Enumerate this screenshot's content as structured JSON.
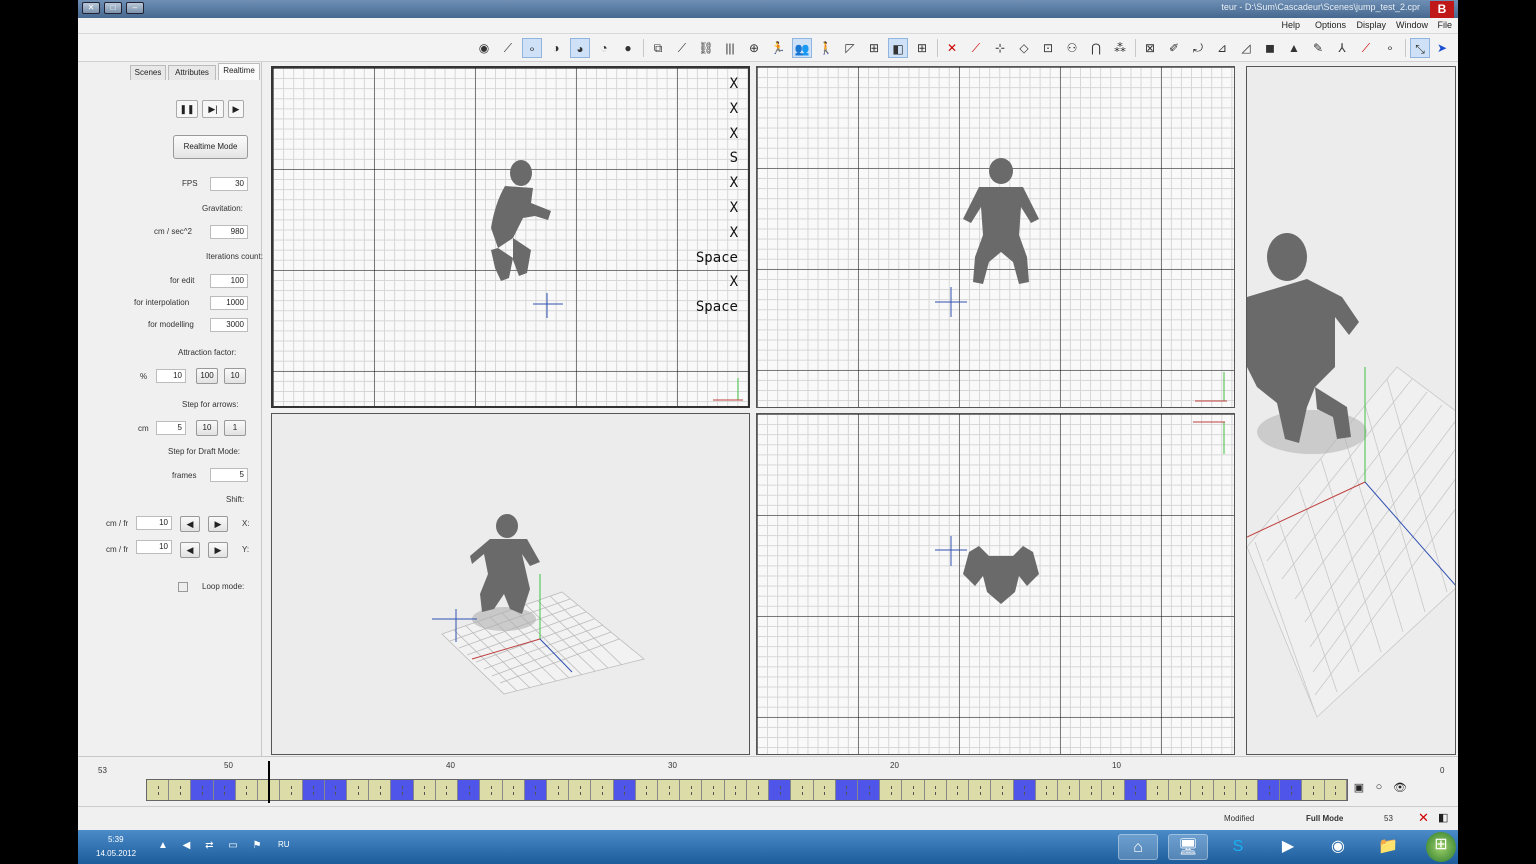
{
  "window": {
    "title": "teur - D:\\Sum\\Cascadeur\\Scenes\\jump_test_2.cpr",
    "logo": "B"
  },
  "menu": [
    {
      "label": "File",
      "id": "menu-file"
    },
    {
      "label": "Window",
      "id": "menu-window"
    },
    {
      "label": "Display",
      "id": "menu-display"
    },
    {
      "label": "Options",
      "id": "menu-options"
    },
    {
      "label": "Help",
      "id": "menu-help"
    }
  ],
  "toolbar_icons": [
    "pointer-icon",
    "move-icon",
    "dot-icon",
    "bone-icon",
    "brush-icon",
    "figure-icon",
    "bone-chain-icon",
    "cube-icon",
    "pencil-icon",
    "triangle-icon",
    "scale-icon",
    "rotate-icon",
    "nodes-icon",
    "node-icon",
    "arch-icon",
    "hierarchy-icon",
    "square-icon",
    "diamond-icon",
    "pin-icon",
    "red-brush-icon",
    "delete-icon",
    "grid4-icon",
    "panel-icon",
    "grid-icon",
    "corner-icon",
    "walk-icon",
    "people-icon",
    "run-icon",
    "target-icon",
    "bars-icon",
    "chain-icon",
    "link-icon",
    "window-icon",
    "dot-icon-2",
    "circle-icon",
    "brush2-icon",
    "pencil2-icon",
    "dot-small-icon",
    "line-icon",
    "pin2-icon"
  ],
  "panel": {
    "tabs": [
      "Realtime",
      "Attributes",
      "Scenes"
    ],
    "playback": {
      "play": "▶",
      "step": "▶|",
      "pause": "❚❚"
    },
    "realtime_mode_label": "Realtime Mode",
    "fps": {
      "label": "FPS",
      "value": "30"
    },
    "gravitation": {
      "title": "Gravitation:",
      "value": "980",
      "unit": "cm / sec^2"
    },
    "iterations": {
      "title": "Iterations count:",
      "edit": {
        "value": "100",
        "label": "for edit"
      },
      "interp": {
        "value": "1000",
        "label": "for interpolation"
      },
      "model": {
        "value": "3000",
        "label": "for modelling"
      }
    },
    "attraction": {
      "title": "Attraction factor:",
      "b1": "10",
      "b2": "100",
      "value": "10",
      "unit": "%"
    },
    "arrows": {
      "title": "Step for arrows:",
      "b1": "1",
      "b2": "10",
      "value": "5",
      "unit": "cm"
    },
    "draft": {
      "title": "Step for Draft Mode:",
      "value": "5",
      "unit": "frames"
    },
    "shift": {
      "title": "Shift:",
      "x": {
        "label": "X:",
        "value": "10",
        "unit": "cm / fr"
      },
      "y": {
        "label": "Y:",
        "value": "10",
        "unit": "cm / fr"
      }
    },
    "loop": {
      "label": "Loop mode:",
      "checked": false
    }
  },
  "viewports": {
    "side_keys": [
      "X",
      "X",
      "X",
      "S",
      "X",
      "X",
      "X",
      "Space",
      "X",
      "Space"
    ]
  },
  "timeline": {
    "start": "0",
    "end": "53",
    "labels": [
      "10",
      "20",
      "30",
      "40",
      "50"
    ],
    "current_frame": 48,
    "total_frames": 54,
    "key_frames": [
      2,
      3,
      9,
      14,
      21,
      22,
      25,
      32,
      36,
      39,
      42,
      45,
      46,
      50,
      51
    ]
  },
  "status": {
    "frame": "53",
    "mode": "Full Mode",
    "state": "Modified"
  },
  "taskbar": {
    "lang": "RU",
    "time": "5:39",
    "date": "14.05.2012",
    "apps": [
      "start-orb",
      "explorer-app",
      "chrome-app",
      "media-app",
      "skype-app",
      "computer-app",
      "cascadeur-app"
    ]
  }
}
